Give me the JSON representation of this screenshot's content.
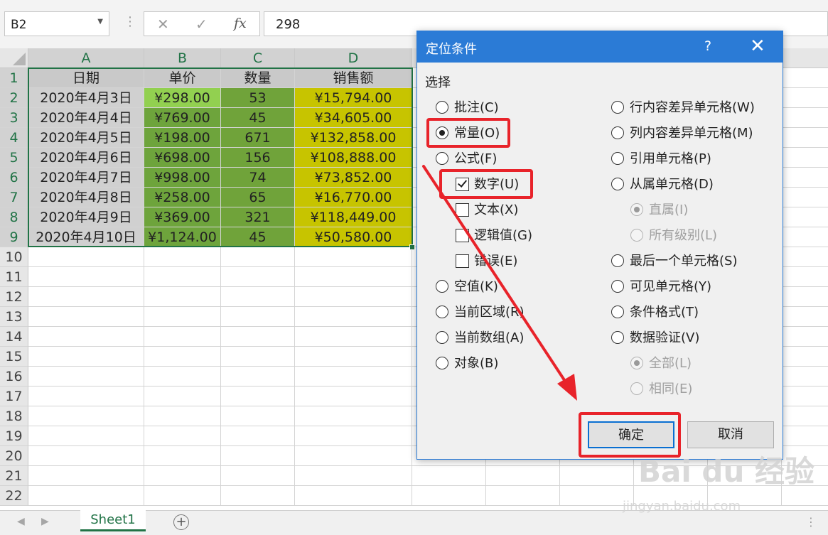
{
  "formula_bar": {
    "name_box": "B2",
    "cancel_icon": "✕",
    "enter_icon": "✓",
    "fx_label": "fx",
    "formula": "298"
  },
  "columns": [
    "A",
    "B",
    "C",
    "D"
  ],
  "rows": [
    "1",
    "2",
    "3",
    "4",
    "5",
    "6",
    "7",
    "8",
    "9",
    "10",
    "11",
    "12",
    "13",
    "14",
    "15",
    "16",
    "17",
    "18",
    "19",
    "20",
    "21",
    "22"
  ],
  "table": {
    "headers": [
      "日期",
      "单价",
      "数量",
      "销售额"
    ],
    "data": [
      [
        "2020年4月3日",
        "¥298.00",
        "53",
        "¥15,794.00"
      ],
      [
        "2020年4月4日",
        "¥769.00",
        "45",
        "¥34,605.00"
      ],
      [
        "2020年4月5日",
        "¥198.00",
        "671",
        "¥132,858.00"
      ],
      [
        "2020年4月6日",
        "¥698.00",
        "156",
        "¥108,888.00"
      ],
      [
        "2020年4月7日",
        "¥998.00",
        "74",
        "¥73,852.00"
      ],
      [
        "2020年4月8日",
        "¥258.00",
        "65",
        "¥16,770.00"
      ],
      [
        "2020年4月9日",
        "¥369.00",
        "321",
        "¥118,449.00"
      ],
      [
        "2020年4月10日",
        "¥1,124.00",
        "45",
        "¥50,580.00"
      ]
    ]
  },
  "colors": {
    "header_fill": "#c9c9c9",
    "date_fill": "#d0d0d0",
    "price_fill": "#6ea43c",
    "price_active_fill": "#92d050",
    "qty_fill": "#70a33a",
    "sales_fill": "#c7c400",
    "dialog_title": "#2b7bd6",
    "highlight": "#e8232a",
    "excel_green": "#217346"
  },
  "sheet_tabs": {
    "active": "Sheet1",
    "add_icon": "+"
  },
  "dialog": {
    "title": "定位条件",
    "help": "?",
    "close": "✕",
    "group_label": "选择",
    "left_options": {
      "comments": "批注(C)",
      "constants": "常量(O)",
      "formulas": "公式(F)",
      "numbers": "数字(U)",
      "text": "文本(X)",
      "logicals": "逻辑值(G)",
      "errors": "错误(E)",
      "blanks": "空值(K)",
      "current_region": "当前区域(R)",
      "current_array": "当前数组(A)",
      "objects": "对象(B)"
    },
    "right_options": {
      "row_diff": "行内容差异单元格(W)",
      "col_diff": "列内容差异单元格(M)",
      "precedents": "引用单元格(P)",
      "dependents": "从属单元格(D)",
      "direct": "直属(I)",
      "all_levels": "所有级别(L)",
      "last_cell": "最后一个单元格(S)",
      "visible": "可见单元格(Y)",
      "cond_format": "条件格式(T)",
      "data_validation": "数据验证(V)",
      "all": "全部(L)",
      "same": "相同(E)"
    },
    "ok": "确定",
    "cancel": "取消"
  },
  "watermark": {
    "logo": "Bai du 经验",
    "sub": "jingyan.baidu.com"
  }
}
